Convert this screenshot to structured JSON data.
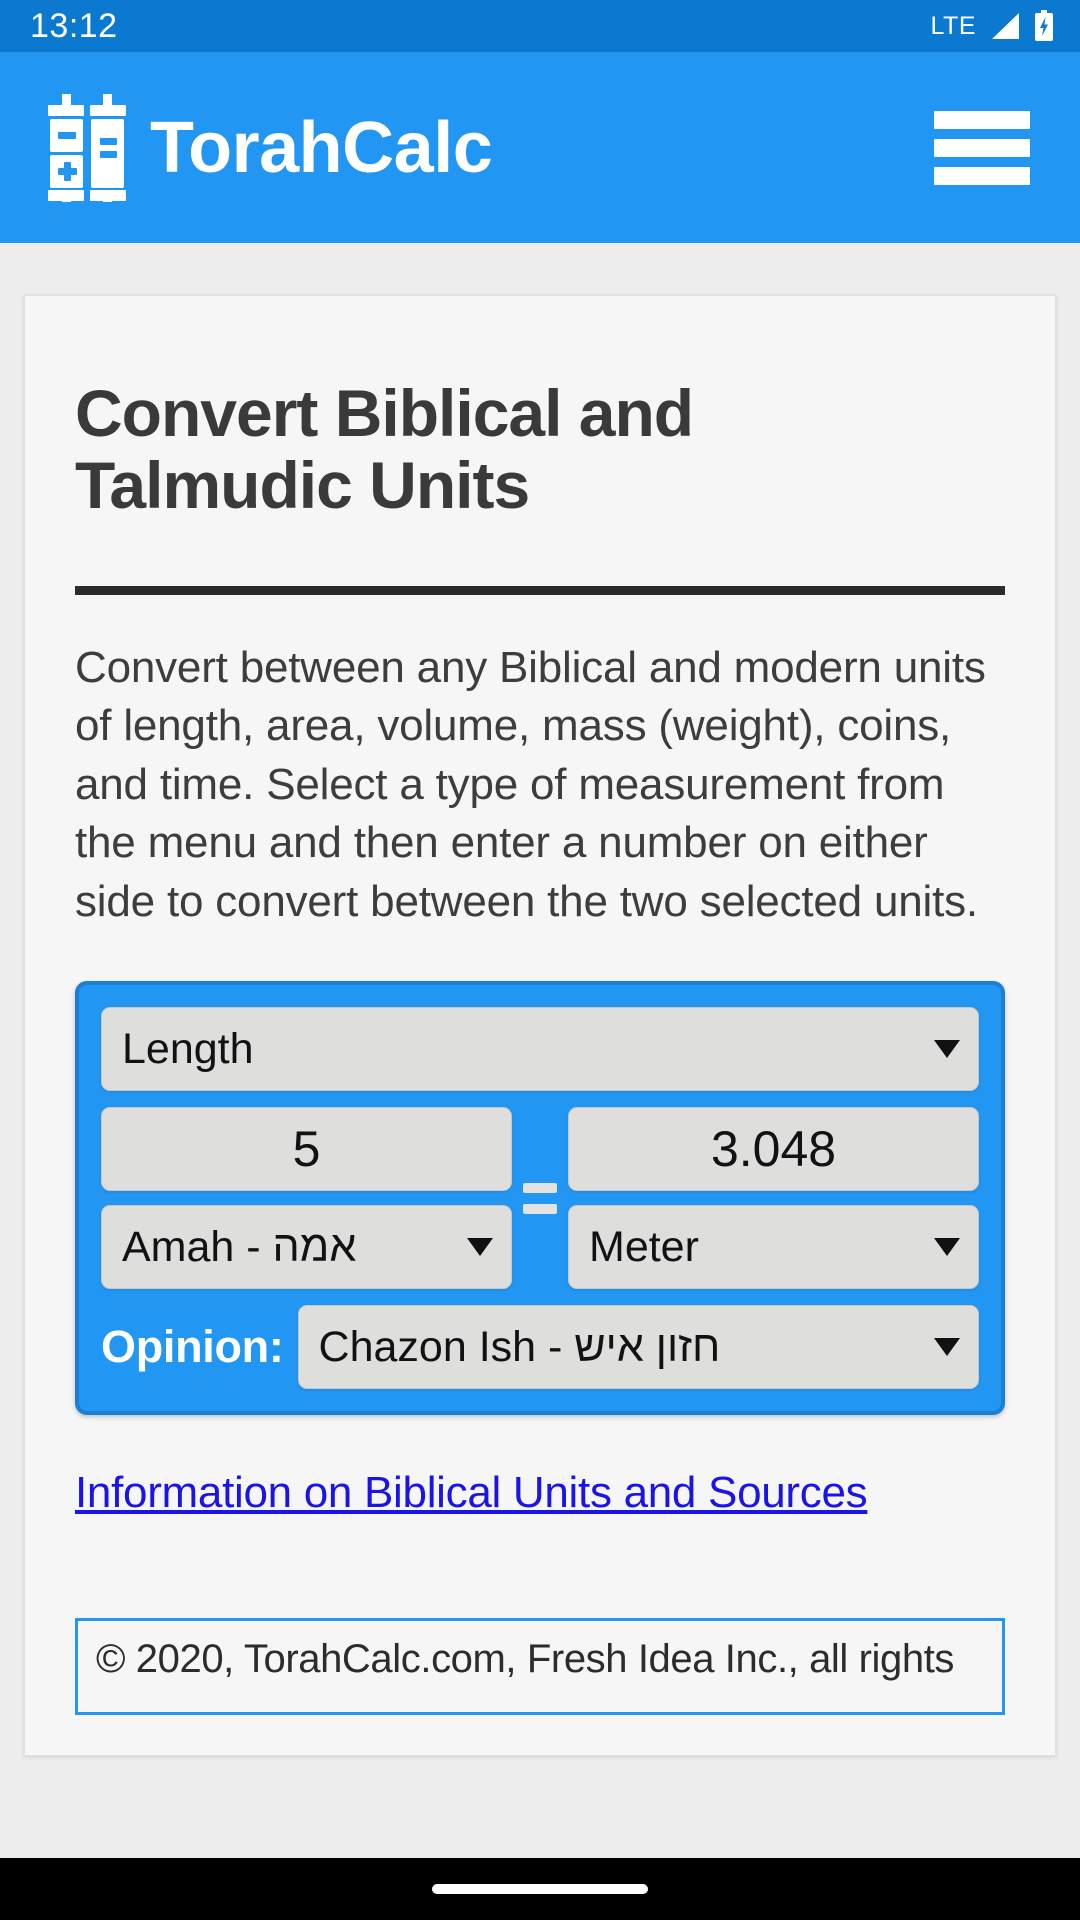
{
  "status_bar": {
    "clock": "13:12",
    "network_label": "LTE",
    "signal_icon": "signal-bars-icon",
    "battery_icon": "battery-charging-icon",
    "background_color": "#0b79cf"
  },
  "header": {
    "logo_icon": "torah-scroll-calculator-icon",
    "brand_title": "TorahCalc",
    "menu_icon": "hamburger-menu-icon",
    "background_color": "#2196f3"
  },
  "main": {
    "page_title": "Convert Biblical and Talmudic Units",
    "intro_paragraph": "Convert between any Biblical and modern units of length, area, volume, mass (weight), coins, and time. Select a type of measurement from the menu and then enter a number on either side to convert between the two selected units.",
    "info_link": "Information on Biblical Units and Sources"
  },
  "calculator": {
    "measurement_type": "Length",
    "left_value": "5",
    "left_unit": "Amah - אמה",
    "equals_symbol": "=",
    "right_value": "3.048",
    "right_unit": "Meter",
    "opinion_label": "Opinion:",
    "opinion_value": "Chazon Ish - חזון איש",
    "caret_icon": "chevron-down-icon",
    "accent_color": "#2196f3",
    "field_color": "#dededd"
  },
  "footer": {
    "copyright": "© 2020, TorahCalc.com, Fresh Idea Inc., all rights",
    "border_color": "#2196f3"
  },
  "nav_bar": {
    "home_indicator": "home-indicator"
  }
}
